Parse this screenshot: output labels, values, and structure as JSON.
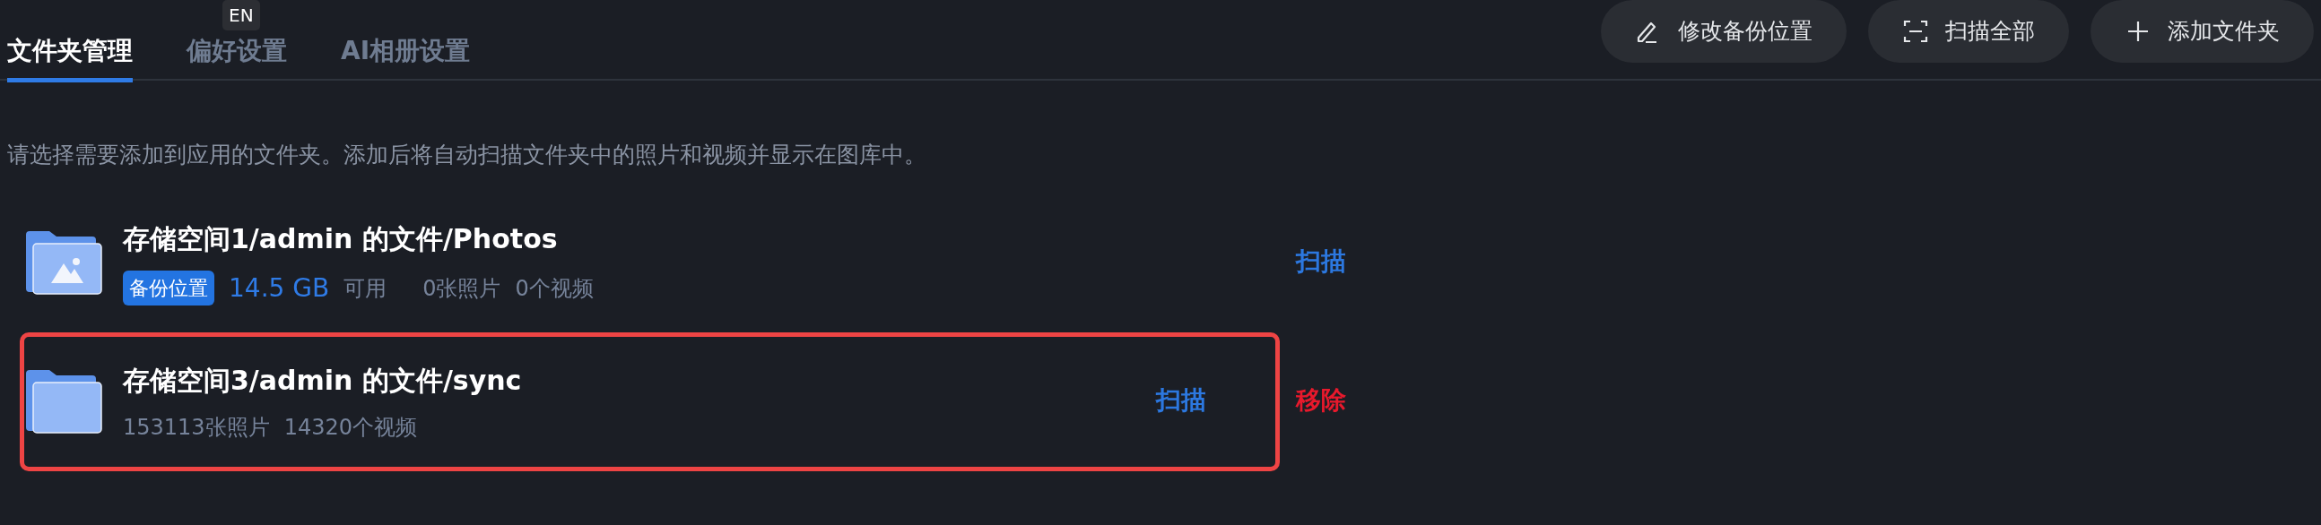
{
  "tabs": [
    {
      "label": "文件夹管理",
      "selected": true
    },
    {
      "label": "偏好设置",
      "selected": false
    },
    {
      "label": "AI相册设置",
      "selected": false
    }
  ],
  "input_indicator": "EN",
  "toolbar": [
    {
      "kind": "edit",
      "label": "修改备份位置"
    },
    {
      "kind": "scan",
      "label": "扫描全部"
    },
    {
      "kind": "add",
      "label": "添加文件夹"
    }
  ],
  "description": "请选择需要添加到应用的文件夹。添加后将自动扫描文件夹中的照片和视频并显示在图库中。",
  "folders": [
    {
      "path": "存储空间1/admin 的文件/Photos",
      "kind": "photos",
      "badge": "备份位置",
      "size": "14.5 GB",
      "size_suffix": "可用",
      "photos": "0张照片",
      "videos": "0个视频",
      "highlighted": false,
      "actions": [
        {
          "kind": "scan",
          "label": "扫描"
        }
      ]
    },
    {
      "path": "存储空间3/admin 的文件/sync",
      "kind": "plain",
      "photos": "153113张照片",
      "videos": "14320个视频",
      "highlighted": true,
      "actions": [
        {
          "kind": "scan",
          "label": "扫描"
        },
        {
          "kind": "remove",
          "label": "移除"
        }
      ]
    }
  ]
}
